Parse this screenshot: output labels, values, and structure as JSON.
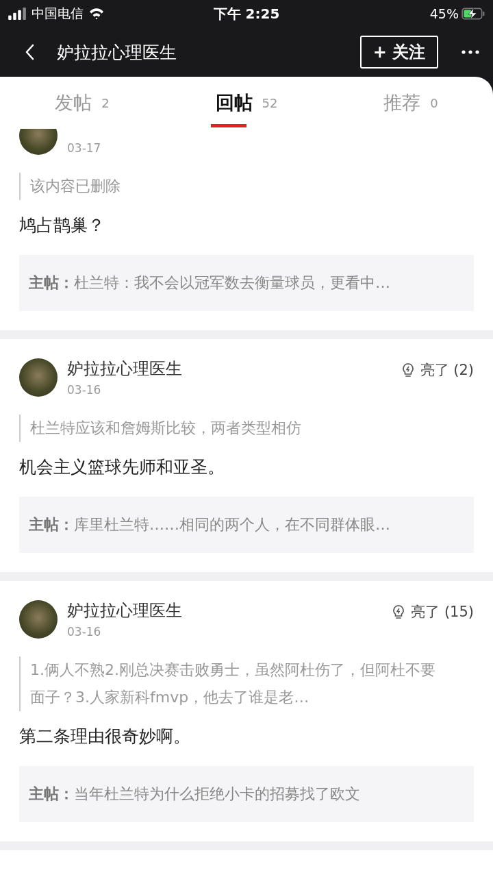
{
  "status_bar": {
    "carrier": "中国电信",
    "time": "下午 2:25",
    "battery": "45%",
    "charging": true
  },
  "nav": {
    "title": "妒拉拉心理医生",
    "follow_button": "+ 关注"
  },
  "tabs": [
    {
      "label": "发帖",
      "count": "2",
      "selected": false
    },
    {
      "label": "回帖",
      "count": "52",
      "selected": true
    },
    {
      "label": "推荐",
      "count": "0",
      "selected": false
    }
  ],
  "posts": [
    {
      "date": "03-17",
      "quote": "该内容已删除",
      "reply": "鸠占鹊巢？",
      "main_label": "主帖：",
      "main_text": "杜兰特：我不会以冠军数去衡量球员，更看中…"
    },
    {
      "name": "妒拉拉心理医生",
      "date": "03-16",
      "likes": "亮了 (2)",
      "quote": "杜兰特应该和詹姆斯比较，两者类型相仿",
      "reply": "机会主义篮球先师和亚圣。",
      "main_label": "主帖：",
      "main_text": "库里杜兰特……相同的两个人，在不同群体眼…"
    },
    {
      "name": "妒拉拉心理医生",
      "date": "03-16",
      "likes": "亮了 (15)",
      "quote": "1.俩人不熟2.刚总决赛击败勇士，虽然阿杜伤了，但阿杜不要面子？3.人家新科fmvp，他去了谁是老…",
      "reply": "第二条理由很奇妙啊。",
      "main_label": "主帖：",
      "main_text": "当年杜兰特为什么拒绝小卡的招募找了欧文"
    }
  ]
}
